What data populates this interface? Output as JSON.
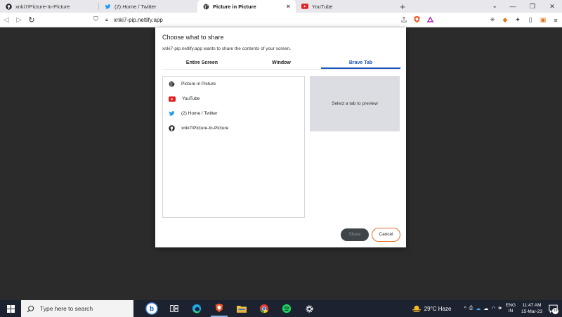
{
  "browser": {
    "tabs": [
      {
        "title": "xnki7/Picture-In-Picture",
        "icon": "github-icon",
        "active": false
      },
      {
        "title": "(2) Home / Twitter",
        "icon": "twitter-icon",
        "active": false
      },
      {
        "title": "Picture in Picture",
        "icon": "globe-icon",
        "active": true,
        "close": "×"
      },
      {
        "title": "YouTube",
        "icon": "youtube-icon",
        "active": false
      }
    ],
    "new_tab": "+",
    "address": "xnki7-pip.netlify.app",
    "window_controls": {
      "minimize": "—",
      "maximize": "❐",
      "close": "✕"
    }
  },
  "dialog": {
    "title": "Choose what to share",
    "subtitle": "xnki7-pip.netlify.app wants to share the contents of your screen.",
    "tabs": [
      "Entire Screen",
      "Window",
      "Brave Tab"
    ],
    "active_tab": "Brave Tab",
    "items": [
      {
        "label": "Picture in Picture",
        "icon": "globe-icon"
      },
      {
        "label": "YouTube",
        "icon": "youtube-icon"
      },
      {
        "label": "(2) Home / Twitter",
        "icon": "twitter-icon"
      },
      {
        "label": "xnki7/Picture-In-Picture",
        "icon": "github-icon"
      }
    ],
    "preview_text": "Select a tab to preview",
    "share_label": "Share",
    "cancel_label": "Cancel"
  },
  "taskbar": {
    "search_placeholder": "Type here to search",
    "weather": "29°C  Haze",
    "language_line1": "ENG",
    "language_line2": "IN",
    "time": "11:47 AM",
    "date": "15-Mar-23",
    "notification_count": "19"
  },
  "colors": {
    "accent_blue": "#1a56b8",
    "cancel_border": "#e0702f",
    "page_bg": "#2b2b2b",
    "taskbar_bg": "#1c2230"
  }
}
